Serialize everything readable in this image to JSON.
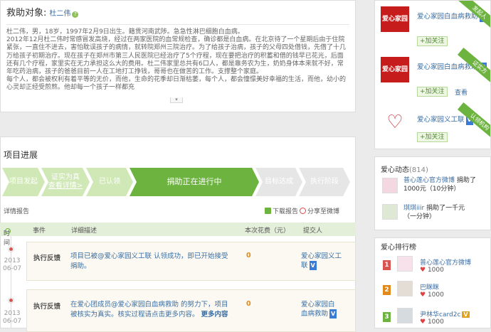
{
  "rescue": {
    "heading": "救助对象:",
    "name": "杜二伟",
    "help_icon": "question-icon",
    "paragraphs": [
      "杜二伟，男，18岁，1997年2月9日出生。籍贯河南武陟。急急性淋巴细胞白血病。",
      "2012年12月杜二伟时常感冒发高烧，经过在两家医院的血常规检查，确诊都是白血病。在北京待了一个星期后由于住院紧张，一直住不进去，害怕耽误孩子的病情，就转院郑州三院治疗。为了给孩子治病，孩子的父母四处借钱，先借了十几万给孩子初期治疗。现在孩子在郑州市第三人民医院已经治疗了5个疗程，现在要把治疗的积蓄和借的钱早已花光，后面还有几个疗程，家里实在无力承担这么大的费用。杜二伟家里总共有6口人，都是靠务农为生，奶奶身体本来就不好，常年吃药治病，孩子的爸爸目前一人在工地打工挣钱，哥哥也在做苦的工作。支撑整个家庭。",
      "每个人，都会被权利有着平等的无价，而他，生命的花季却日渐枯萎，每个人，都会憧憬美好幸福的生活，而他，幼小的心灵却正经受煎熬。他却每一个孩子一样都充"
    ],
    "expand_icon": "chevron-down-icon"
  },
  "progress": {
    "title": "项目进展",
    "steps": [
      {
        "label": "项目发起",
        "state": "done"
      },
      {
        "label": "证实为真",
        "sub": "查看详情>",
        "state": "done"
      },
      {
        "label": "已认领",
        "state": "done"
      },
      {
        "label": "捐助正在进行中",
        "state": "active"
      },
      {
        "label": "目标达成",
        "state": "todo"
      },
      {
        "label": "执行阶段",
        "state": "todo"
      }
    ],
    "report_label": "详情报告",
    "download_label": "下载报告",
    "share_label": "分享至微博",
    "columns": [
      "时间",
      "事件",
      "详细描述",
      "本次花费（元）",
      "提交人"
    ],
    "rows": [
      {
        "year": "2013",
        "date": "06-07",
        "type": "执行反馈",
        "desc": "项目已被@爱心家园义工联 认领成功，即已开始接受捐助。",
        "cost": "0",
        "submitter": "爱心家园义工联"
      },
      {
        "year": "2013",
        "date": "06-07",
        "type": "执行反馈",
        "desc": "在爱心团成员@爱心家园白血病救助 的努力下，项目被核实为真实。核实过程请点击更多内容。",
        "more": "更多内容",
        "cost": "0",
        "submitter": "爱心家园白血病救助"
      }
    ]
  },
  "orgs": [
    {
      "logo_text": "爱心家园",
      "name": "爱心家园白血病救助",
      "follow": "+加关注",
      "ribbon": "发起人"
    },
    {
      "logo_text": "爱心家园",
      "name": "爱心家园白血病救助",
      "follow": "+加关注",
      "look": "查看",
      "ribbon": "证实方"
    },
    {
      "logo_text": "♡",
      "name": "爱心家园义工联",
      "follow": "+加关注",
      "ribbon": "认领机构"
    }
  ],
  "dynamic": {
    "title": "爱心动态",
    "count": "(814)",
    "items": [
      {
        "user": "普心莲心官方微博",
        "action": "捐助了",
        "amount": "1000元",
        "time": "（10分钟）"
      },
      {
        "user": "琪琪iiir",
        "action": "捐助了",
        "amount": "一千元",
        "time": "（一分钟）"
      }
    ]
  },
  "ranking": {
    "title": "爱心排行榜",
    "items": [
      {
        "rank": "1",
        "user": "普心莲心官方微博",
        "love": "1000"
      },
      {
        "rank": "2",
        "user": "巴眯眯",
        "love": "1000"
      },
      {
        "rank": "3",
        "user": "尹林华card2c",
        "love": "1000"
      }
    ]
  },
  "colors": {
    "green": "#6db33f",
    "link": "#3a6ea5",
    "orange": "#e08a1e",
    "red": "#d9534f",
    "rank1": "#d9534f",
    "rank2": "#e08a1e",
    "rank3": "#6db33f"
  }
}
